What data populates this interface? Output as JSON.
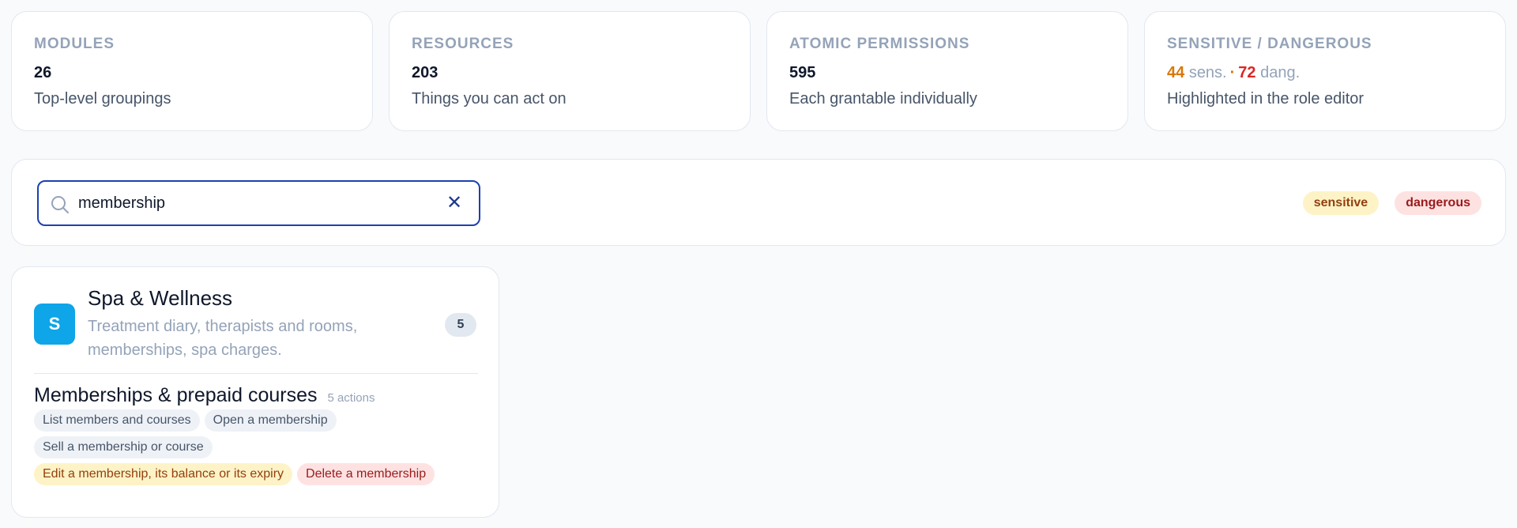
{
  "stats": [
    {
      "label": "MODULES",
      "value": "26",
      "sub": "Top-level groupings"
    },
    {
      "label": "RESOURCES",
      "value": "203",
      "sub": "Things you can act on"
    },
    {
      "label": "ATOMIC PERMISSIONS",
      "value": "595",
      "sub": "Each grantable individually"
    }
  ],
  "sensitive_stat": {
    "label": "SENSITIVE / DANGEROUS",
    "sens_count": "44",
    "sens_word": "sens.",
    "separator": "·",
    "dang_count": "72",
    "dang_word": "dang.",
    "sub": "Highlighted in the role editor"
  },
  "search": {
    "value": "membership",
    "clear_label": "✕"
  },
  "legend": {
    "sensitive": "sensitive",
    "dangerous": "dangerous"
  },
  "module": {
    "avatar_letter": "S",
    "title": "Spa & Wellness",
    "description": "Treatment diary, therapists and rooms, memberships, spa charges.",
    "count": "5",
    "resource": {
      "title": "Memberships & prepaid courses",
      "count_label": "5 actions",
      "actions": [
        {
          "label": "List members and courses",
          "level": "normal"
        },
        {
          "label": "Open a membership",
          "level": "normal"
        },
        {
          "label": "Sell a membership or course",
          "level": "normal"
        },
        {
          "label": "Edit a membership, its balance or its expiry",
          "level": "sensitive"
        },
        {
          "label": "Delete a membership",
          "level": "dangerous"
        }
      ]
    }
  },
  "colors": {
    "accent": "#1e40af",
    "sensitive": "#d97706",
    "dangerous": "#dc2626",
    "module_avatar": "#0ea5e9"
  }
}
